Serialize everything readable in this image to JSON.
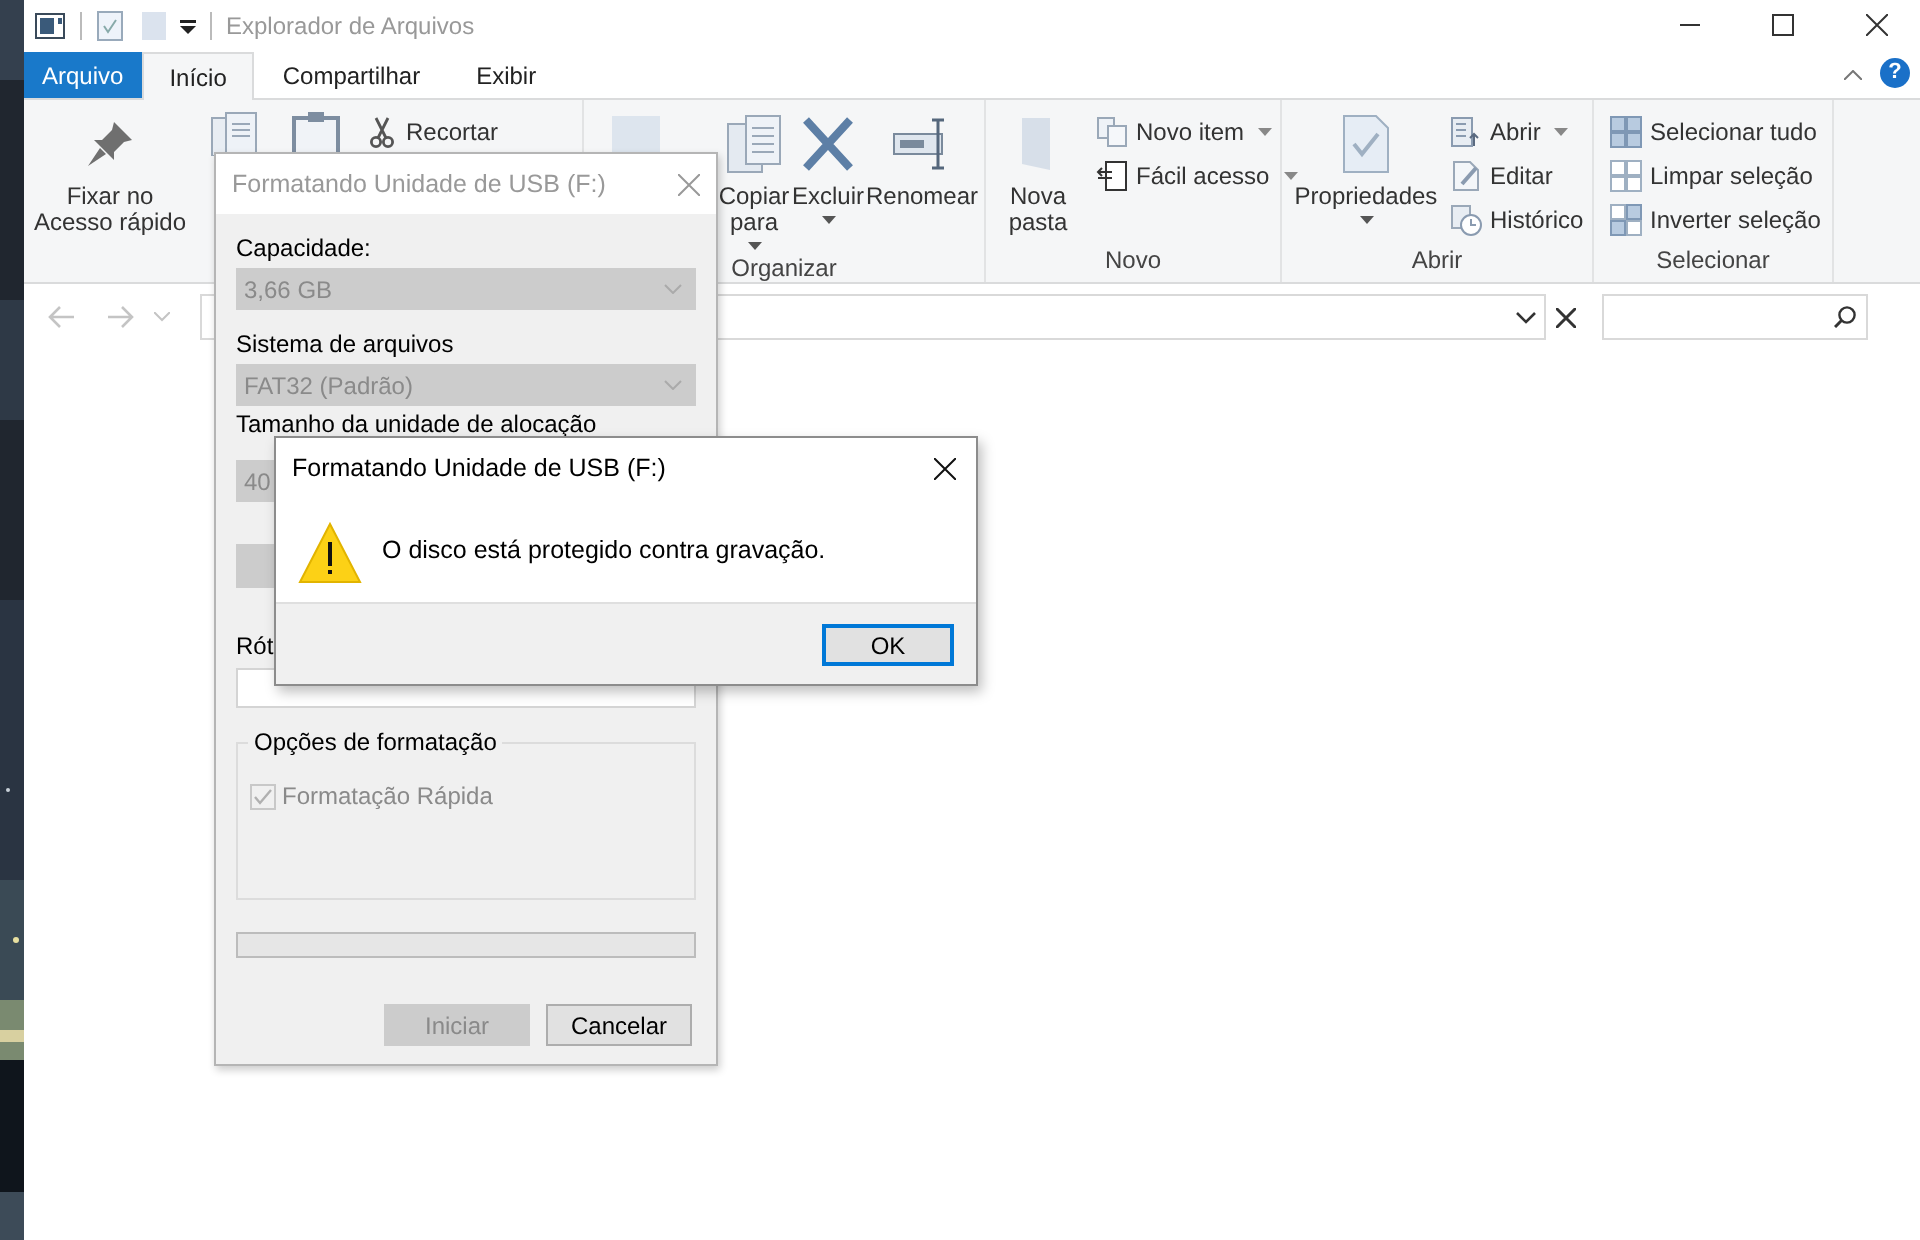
{
  "window": {
    "title": "Explorador de Arquivos"
  },
  "tabs": [
    {
      "label": "Arquivo",
      "kind": "file",
      "selected": false
    },
    {
      "label": "Início",
      "kind": "tab",
      "selected": true
    },
    {
      "label": "Compartilhar",
      "kind": "tab",
      "selected": false
    },
    {
      "label": "Exibir",
      "kind": "tab",
      "selected": false
    }
  ],
  "help": "?",
  "ribbon": [
    {
      "items": [
        {
          "kind": "large",
          "label": "Fixar no Acesso rápido"
        },
        {
          "kind": "icon"
        },
        {
          "kind": "icon"
        },
        {
          "kind": "small",
          "label": "Recortar"
        }
      ]
    },
    {
      "label": "Organizar",
      "items": [
        {
          "kind": "icon"
        },
        {
          "kind": "large",
          "label": "Copiar para",
          "dropdown": true
        },
        {
          "kind": "large",
          "label": "Excluir",
          "dropdown": true
        },
        {
          "kind": "large",
          "label": "Renomear"
        }
      ]
    },
    {
      "label": "Novo",
      "items": [
        {
          "kind": "large",
          "label": "Nova pasta"
        },
        {
          "kind": "small",
          "label": "Novo item",
          "dropdown": true
        },
        {
          "kind": "small",
          "label": "Fácil acesso",
          "dropdown": true
        }
      ]
    },
    {
      "label": "Abrir",
      "items": [
        {
          "kind": "large",
          "label": "Propriedades",
          "dropdown": true
        },
        {
          "kind": "small",
          "label": "Abrir",
          "dropdown": true
        },
        {
          "kind": "small",
          "label": "Editar"
        },
        {
          "kind": "small",
          "label": "Histórico"
        }
      ]
    },
    {
      "label": "Selecionar",
      "items": [
        {
          "kind": "small",
          "label": "Selecionar tudo"
        },
        {
          "kind": "small",
          "label": "Limpar seleção"
        },
        {
          "kind": "small",
          "label": "Inverter seleção"
        }
      ]
    }
  ],
  "format_dialog": {
    "title": "Formatando Unidade de USB (F:)",
    "fields": [
      {
        "label": "Capacidade:",
        "value": "3,66 GB",
        "disabled": true
      },
      {
        "label": "Sistema de arquivos",
        "value": "FAT32 (Padrão)",
        "disabled": true
      },
      {
        "label": "Tamanho da unidade de alocação",
        "value": "40",
        "disabled": true
      }
    ],
    "volume_label": {
      "label": "Rót"
    },
    "options": {
      "title": "Opções de formatação",
      "checkbox": {
        "label": "Formatação Rápida",
        "checked": true,
        "disabled": true
      }
    },
    "progress": {
      "level": 0
    },
    "buttons": [
      {
        "label": "Iniciar",
        "disabled": true
      },
      {
        "label": "Cancelar",
        "disabled": false
      }
    ]
  },
  "message_box": {
    "title": "Formatando Unidade de USB (F:)",
    "message": "O disco está protegido contra gravação.",
    "buttons": [
      {
        "label": "OK",
        "default": true
      }
    ]
  }
}
